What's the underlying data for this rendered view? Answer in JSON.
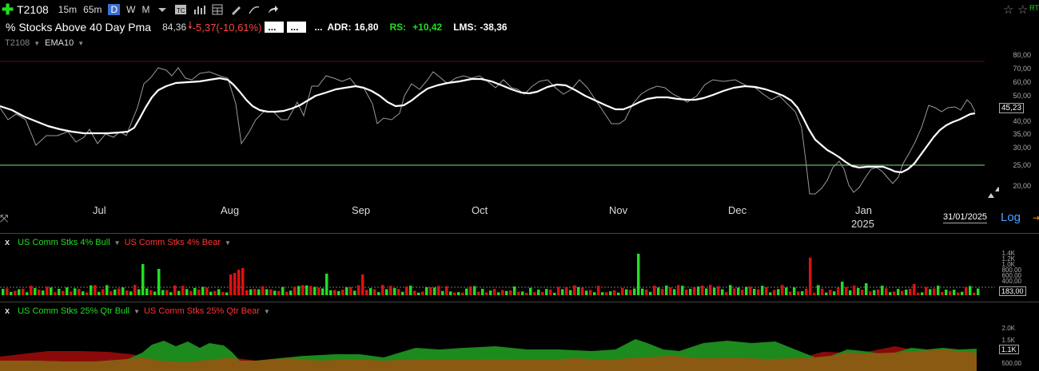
{
  "toolbar": {
    "symbol": "T2108",
    "intervals": [
      "15m",
      "65m",
      "D",
      "W",
      "M"
    ],
    "selected_interval": "D"
  },
  "header": {
    "name": "% Stocks Above 40 Day Pma",
    "price": "84,36",
    "change": "-5,37",
    "change_pct": "(-10,61%)",
    "dots1": "...",
    "dots2": "...",
    "dots3": "...",
    "adr_label": "ADR:",
    "adr_value": "16,80",
    "rs_label": "RS:",
    "rs_value": "+10,42",
    "lms_label": "LMS:",
    "lms_value": "-38,36"
  },
  "main_panel": {
    "symbol_label": "T2108",
    "indicator_label": "EMA10",
    "y_ticks": [
      "80,00",
      "70,00",
      "60,00",
      "50,00",
      "40,00",
      "35,00",
      "30,00",
      "25,00",
      "20,00"
    ],
    "current_value": "45,23",
    "x_labels": [
      "Jul",
      "Aug",
      "Sep",
      "Oct",
      "Nov",
      "Dec",
      "Jan"
    ],
    "year_label": "2025",
    "date_box": "31/01/2025",
    "log_label": "Log"
  },
  "panel2": {
    "close_label": "x",
    "bull_label": "US Comm Stks 4% Bull",
    "bear_label": "US Comm Stks 4% Bear",
    "y_ticks": [
      "1.4K",
      "1.2K",
      "1.0K",
      "800,00",
      "600,00",
      "400,00"
    ],
    "current_value": "183,00"
  },
  "panel3": {
    "close_label": "x",
    "bull_label": "US Comm Stks 25% Qtr Bull",
    "bear_label": "US Comm Stks 25% Qtr Bear",
    "y_ticks": [
      "2.0K",
      "1.5K",
      "500,00"
    ],
    "current_value": "1.1K"
  },
  "colors": {
    "bull": "#22dd22",
    "bear": "#dd1111",
    "ema": "#ffffff",
    "price_line": "#9a9a9a",
    "level_line": "#7be07b",
    "down": "#ff4444",
    "up": "#22dd22"
  }
}
